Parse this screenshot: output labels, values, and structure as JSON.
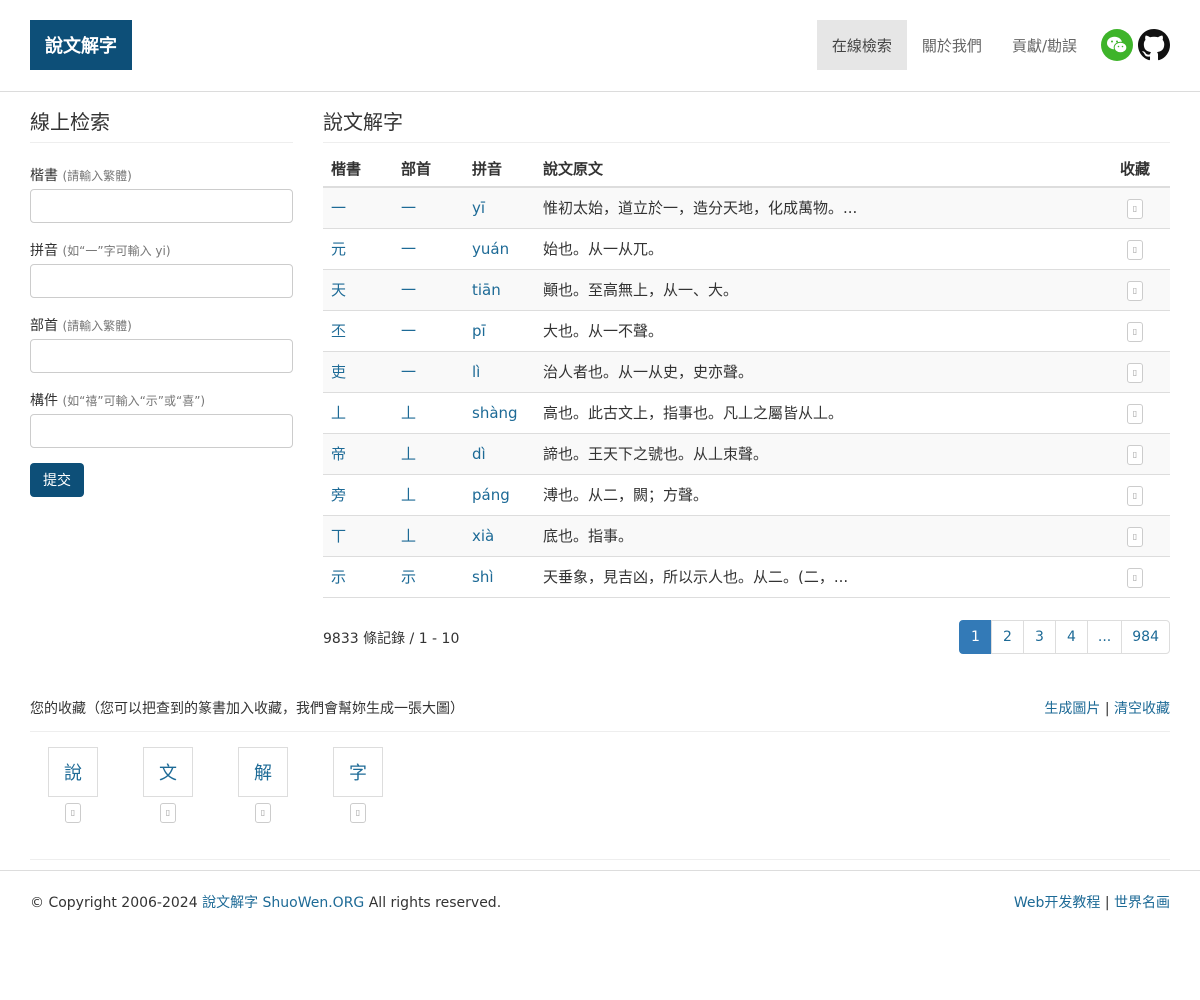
{
  "header": {
    "logo": "說文解字",
    "nav": [
      "在線檢索",
      "關於我們",
      "貢獻/勘誤"
    ],
    "wechat_icon": "wechat-icon",
    "github_icon": "github-icon"
  },
  "sidebar": {
    "title": "線上检索",
    "fields": [
      {
        "label": "楷書",
        "hint": "(請輸入繁體)",
        "value": ""
      },
      {
        "label": "拼音",
        "hint": "(如“一”字可輸入 yi)",
        "value": ""
      },
      {
        "label": "部首",
        "hint": "(請輸入繁體)",
        "value": ""
      },
      {
        "label": "構件",
        "hint": "(如“禧”可輸入“示”或“喜”)",
        "value": ""
      }
    ],
    "submit": "提交"
  },
  "main": {
    "title": "說文解字",
    "columns": [
      "楷書",
      "部首",
      "拼音",
      "說文原文",
      "收藏"
    ],
    "rows": [
      {
        "char": "一",
        "radical": "一",
        "pinyin": "yī",
        "text": "惟初太始，道立於一，造分天地，化成萬物。..."
      },
      {
        "char": "元",
        "radical": "一",
        "pinyin": "yuán",
        "text": "始也。从一从兀。"
      },
      {
        "char": "天",
        "radical": "一",
        "pinyin": "tiān",
        "text": "顚也。至高無上，从一、大。"
      },
      {
        "char": "丕",
        "radical": "一",
        "pinyin": "pī",
        "text": "大也。从一不聲。"
      },
      {
        "char": "吏",
        "radical": "一",
        "pinyin": "lì",
        "text": "治人者也。从一从史，史亦聲。"
      },
      {
        "char": "丄",
        "radical": "丄",
        "pinyin": "shàng",
        "text": "高也。此古文上，指事也。凡丄之屬皆从丄。"
      },
      {
        "char": "帝",
        "radical": "丄",
        "pinyin": "dì",
        "text": "諦也。王天下之號也。从丄朿聲。"
      },
      {
        "char": "旁",
        "radical": "丄",
        "pinyin": "páng",
        "text": "溥也。从二，闕；方聲。"
      },
      {
        "char": "丅",
        "radical": "丄",
        "pinyin": "xià",
        "text": "底也。指事。"
      },
      {
        "char": "示",
        "radical": "示",
        "pinyin": "shì",
        "text": "天垂象，見吉凶，所以示人也。从二。(二，..."
      }
    ],
    "fav_glyph": "▯",
    "summary": "9833 條記錄 / 1 - 10",
    "pages": [
      "1",
      "2",
      "3",
      "4",
      "...",
      "984"
    ]
  },
  "favorites": {
    "title": "您的收藏（您可以把查到的篆書加入收藏，我們會幫妳生成一張大圖）",
    "generate": "生成圖片",
    "separator": "|",
    "clear": "清空收藏",
    "chars": [
      "說",
      "文",
      "解",
      "字"
    ],
    "remove_glyph": "▯"
  },
  "footer": {
    "copyright": "© Copyright 2006-2024",
    "site_link": "說文解字 ShuoWen.ORG",
    "rights": "All rights reserved.",
    "link1": "Web开发教程",
    "separator": "|",
    "link2": "世界名画"
  }
}
